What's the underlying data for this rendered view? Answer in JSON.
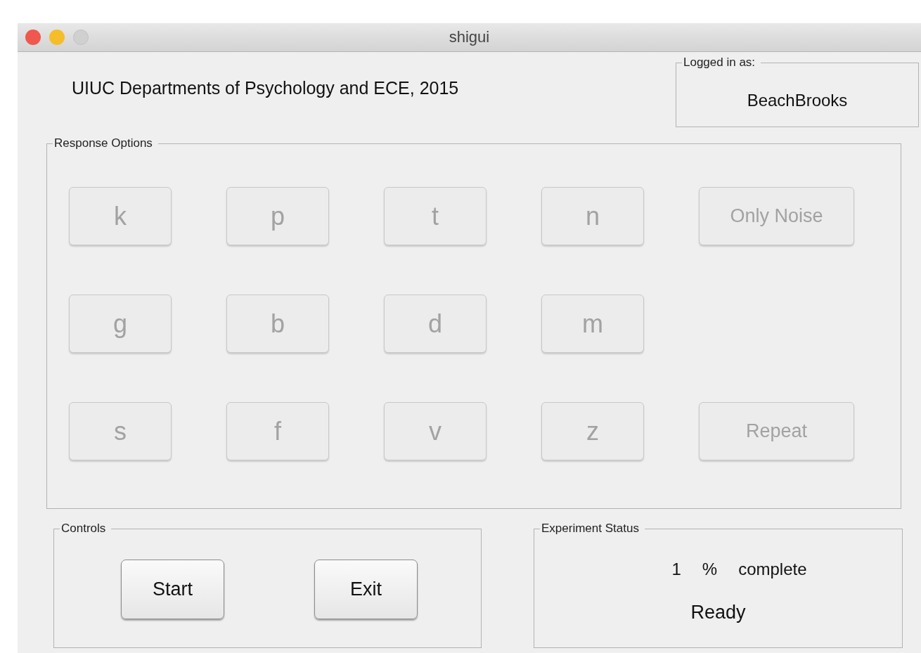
{
  "window": {
    "title": "shigui"
  },
  "header": {
    "text": "UIUC Departments of Psychology and ECE, 2015"
  },
  "login": {
    "title": "Logged in as:",
    "user": "BeachBrooks"
  },
  "response_options": {
    "title": "Response Options",
    "rows": [
      [
        {
          "label": "k",
          "disabled": true,
          "kind": "letter"
        },
        {
          "label": "p",
          "disabled": true,
          "kind": "letter"
        },
        {
          "label": "t",
          "disabled": true,
          "kind": "letter"
        },
        {
          "label": "n",
          "disabled": true,
          "kind": "letter"
        },
        {
          "label": "Only Noise",
          "disabled": true,
          "kind": "wide"
        }
      ],
      [
        {
          "label": "g",
          "disabled": true,
          "kind": "letter"
        },
        {
          "label": "b",
          "disabled": true,
          "kind": "letter"
        },
        {
          "label": "d",
          "disabled": true,
          "kind": "letter"
        },
        {
          "label": "m",
          "disabled": true,
          "kind": "letter"
        }
      ],
      [
        {
          "label": "s",
          "disabled": true,
          "kind": "letter"
        },
        {
          "label": "f",
          "disabled": true,
          "kind": "letter"
        },
        {
          "label": "v",
          "disabled": true,
          "kind": "letter"
        },
        {
          "label": "z",
          "disabled": true,
          "kind": "letter"
        },
        {
          "label": "Repeat",
          "disabled": true,
          "kind": "wide"
        }
      ]
    ]
  },
  "controls": {
    "title": "Controls",
    "buttons": [
      {
        "label": "Start",
        "disabled": false
      },
      {
        "label": "Exit",
        "disabled": false
      }
    ]
  },
  "status": {
    "title": "Experiment Status",
    "percent": "1",
    "percent_sign": "%",
    "complete": "complete",
    "state": "Ready"
  }
}
